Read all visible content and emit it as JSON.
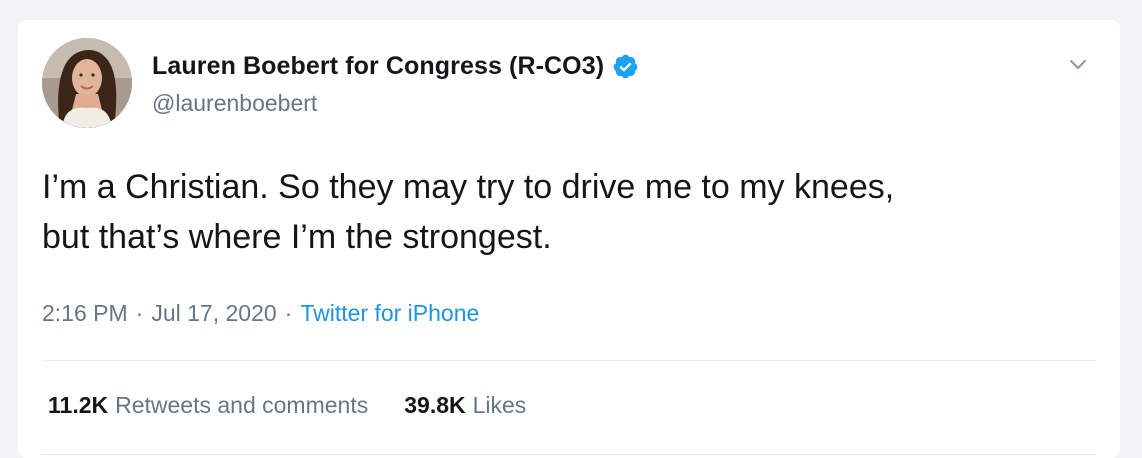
{
  "author": {
    "display_name": "Lauren Boebert for Congress (R-CO3)",
    "handle": "@laurenboebert",
    "verified": true,
    "avatar_icon": "profile-photo"
  },
  "tweet": {
    "text_line1": "I’m a Christian. So they may try to drive me to my knees,",
    "text_line2": "but that’s where I’m the strongest.",
    "time": "2:16 PM",
    "date": "Jul 17, 2020",
    "separator": "·",
    "source": "Twitter for iPhone"
  },
  "stats": {
    "retweets_count": "11.2K",
    "retweets_label": "Retweets and comments",
    "likes_count": "39.8K",
    "likes_label": "Likes"
  },
  "colors": {
    "text_primary": "#14171a",
    "text_secondary": "#657786",
    "link": "#1b95e0",
    "verified_badge": "#1da1f2",
    "divider": "#e6ecf0"
  },
  "icons": {
    "verified": "verified-badge-icon",
    "menu": "chevron-down-icon"
  }
}
